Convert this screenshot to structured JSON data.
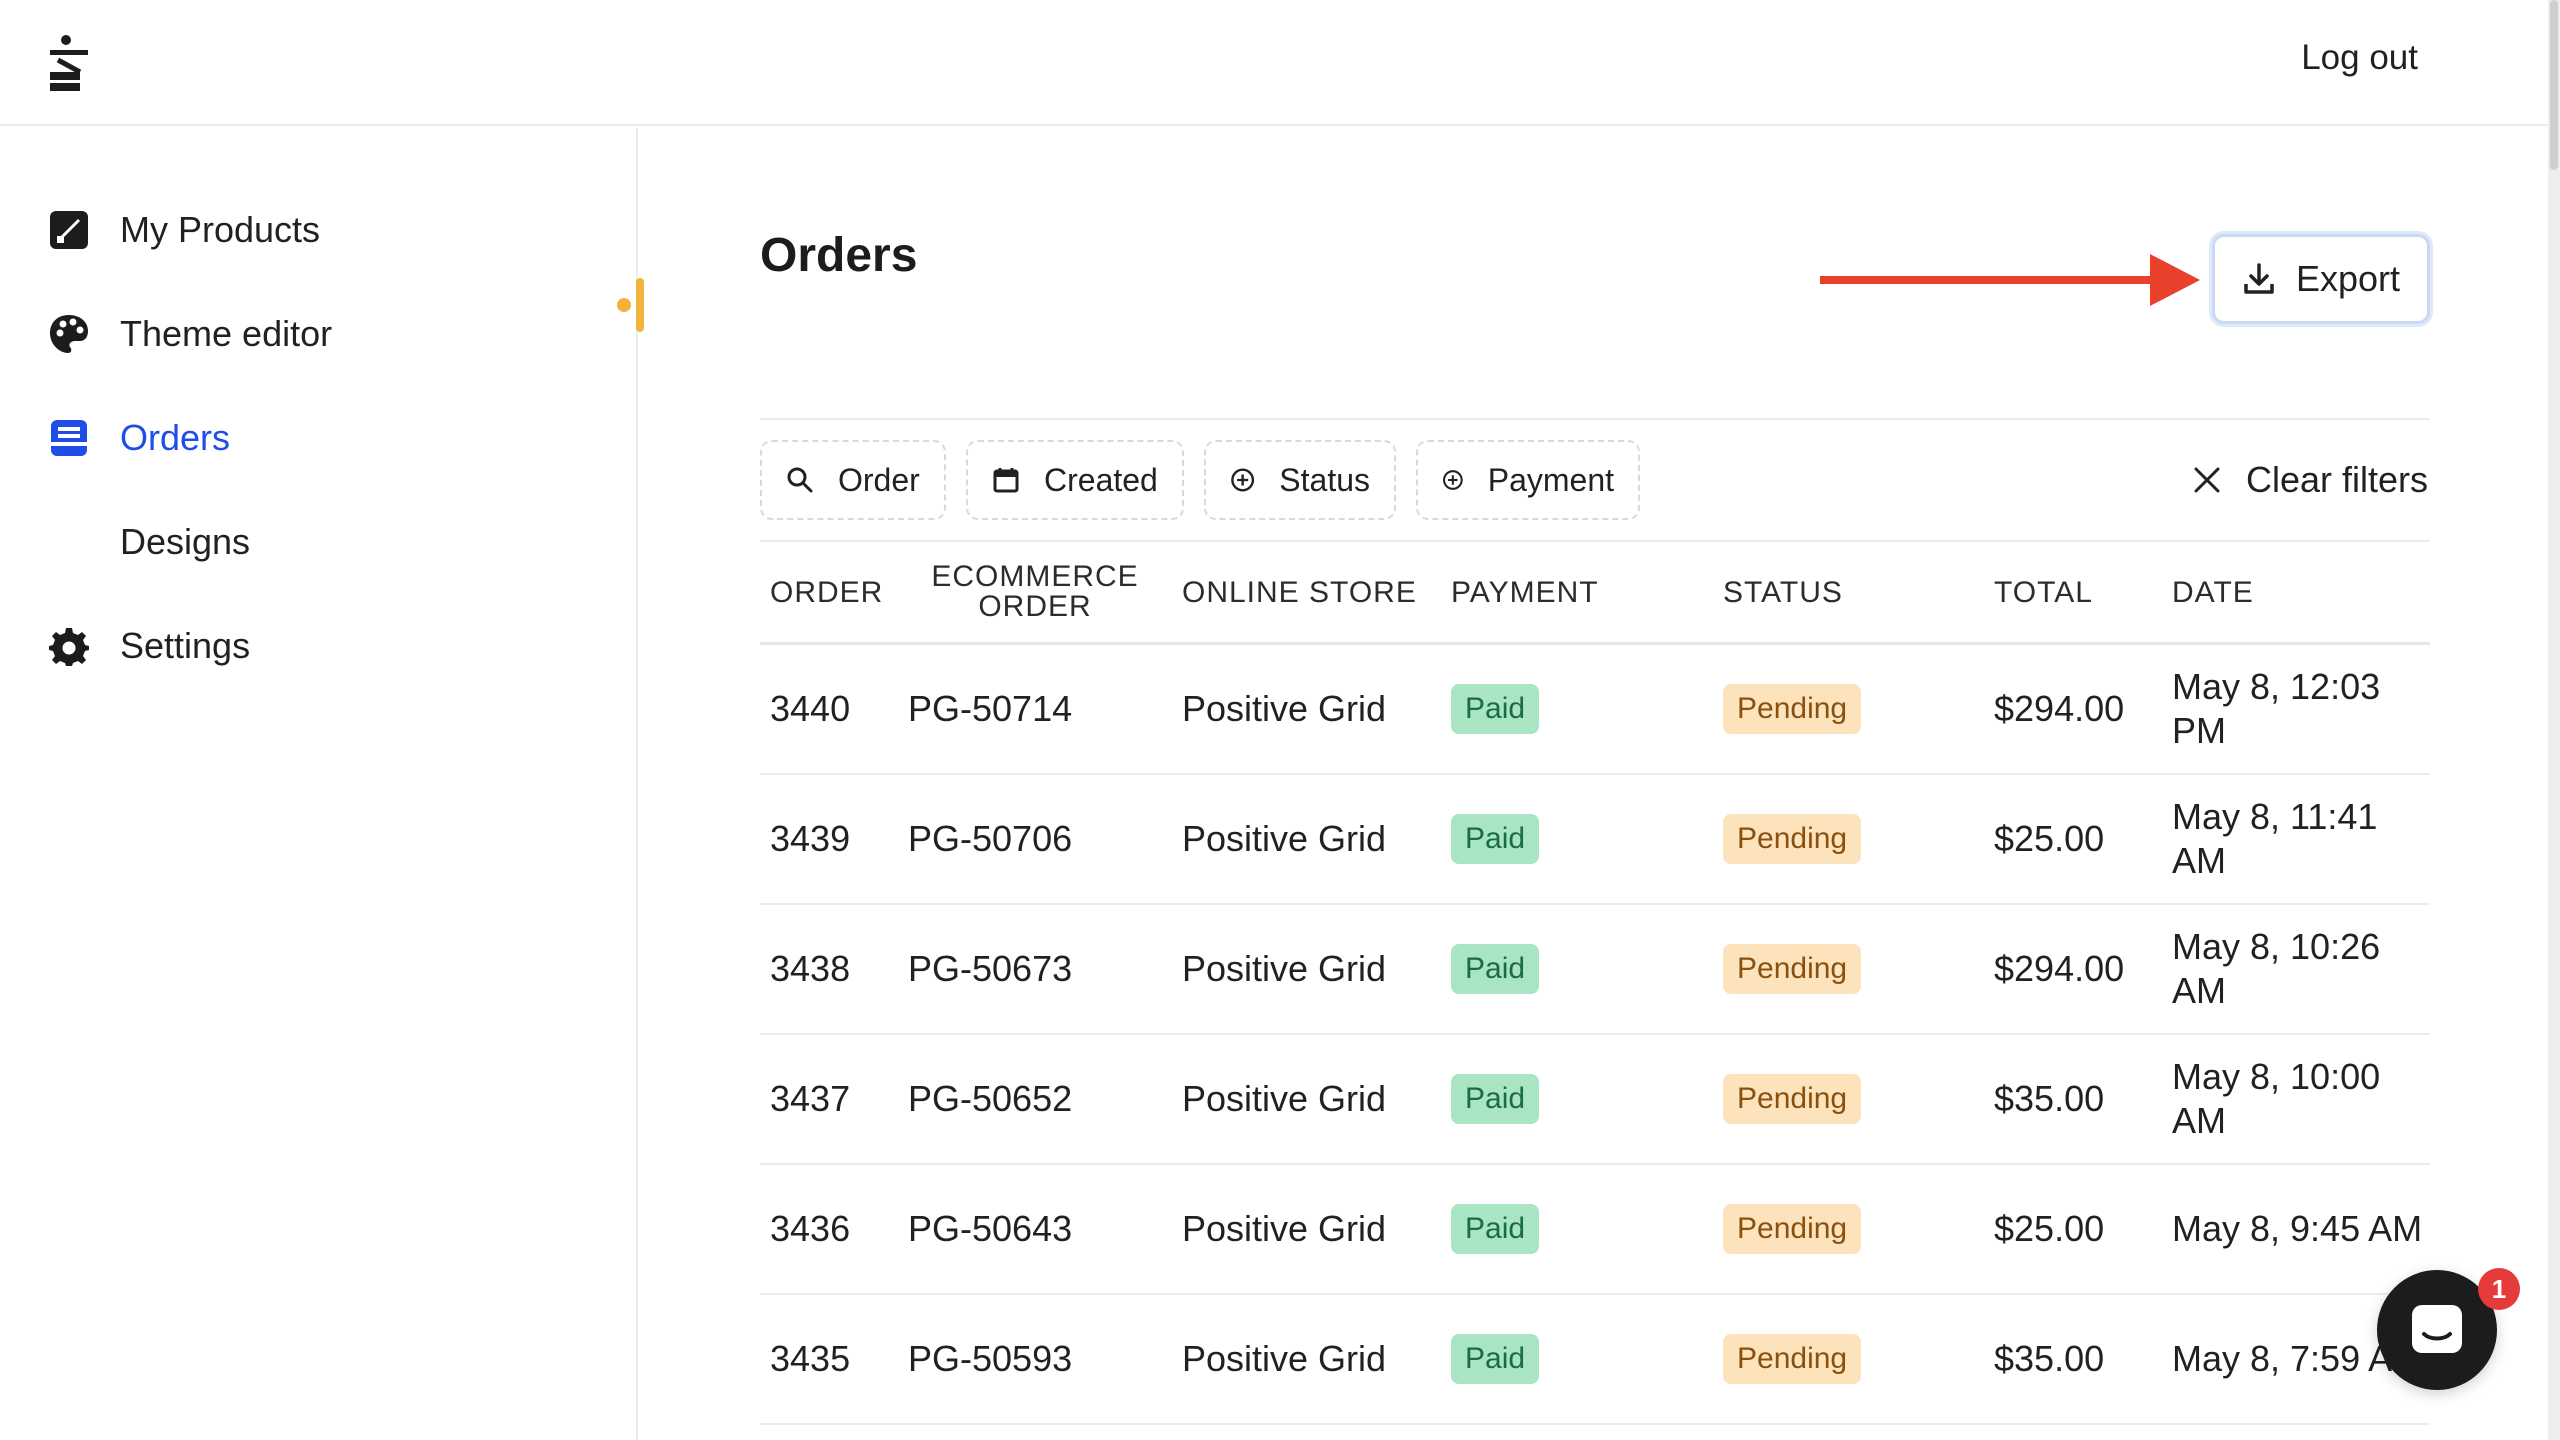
{
  "header": {
    "logout_label": "Log out"
  },
  "sidebar": {
    "items": [
      {
        "label": "My Products",
        "icon": "my-products-icon",
        "active": false
      },
      {
        "label": "Theme editor",
        "icon": "palette-icon",
        "active": false
      },
      {
        "label": "Orders",
        "icon": "orders-icon",
        "active": true
      },
      {
        "label": "Designs",
        "icon": "",
        "active": false
      },
      {
        "label": "Settings",
        "icon": "gear-icon",
        "active": false
      }
    ]
  },
  "main": {
    "title": "Orders",
    "export_label": "Export",
    "filters": [
      {
        "label": "Order",
        "icon": "search-icon"
      },
      {
        "label": "Created",
        "icon": "calendar-icon"
      },
      {
        "label": "Status",
        "icon": "plus-circle-icon"
      },
      {
        "label": "Payment",
        "icon": "plus-circle-icon"
      }
    ],
    "clear_filters_label": "Clear filters",
    "table": {
      "headers": {
        "order": "Order",
        "ecommerce_line1": "Ecommerce",
        "ecommerce_line2": "Order",
        "store": "Online Store",
        "payment": "Payment",
        "status": "Status",
        "total": "Total",
        "date": "Date"
      },
      "rows": [
        {
          "order": "3440",
          "ecommerce": "PG-50714",
          "store": "Positive Grid",
          "payment": "Paid",
          "status": "Pending",
          "total": "$294.00",
          "date": "May 8, 12:03 PM"
        },
        {
          "order": "3439",
          "ecommerce": "PG-50706",
          "store": "Positive Grid",
          "payment": "Paid",
          "status": "Pending",
          "total": "$25.00",
          "date": "May 8, 11:41 AM"
        },
        {
          "order": "3438",
          "ecommerce": "PG-50673",
          "store": "Positive Grid",
          "payment": "Paid",
          "status": "Pending",
          "total": "$294.00",
          "date": "May 8, 10:26 AM"
        },
        {
          "order": "3437",
          "ecommerce": "PG-50652",
          "store": "Positive Grid",
          "payment": "Paid",
          "status": "Pending",
          "total": "$35.00",
          "date": "May 8, 10:00 AM"
        },
        {
          "order": "3436",
          "ecommerce": "PG-50643",
          "store": "Positive Grid",
          "payment": "Paid",
          "status": "Pending",
          "total": "$25.00",
          "date": "May 8, 9:45 AM"
        },
        {
          "order": "3435",
          "ecommerce": "PG-50593",
          "store": "Positive Grid",
          "payment": "Paid",
          "status": "Pending",
          "total": "$35.00",
          "date": "May 8, 7:59 AM"
        }
      ]
    }
  },
  "chat": {
    "unread_count": "1",
    "icon": "chat-icon"
  },
  "colors": {
    "accent": "#1f4de8",
    "arrow": "#e8402a",
    "marker": "#f3b23a",
    "paid_bg": "#a9e4c3",
    "pending_bg": "#fde3bc"
  }
}
